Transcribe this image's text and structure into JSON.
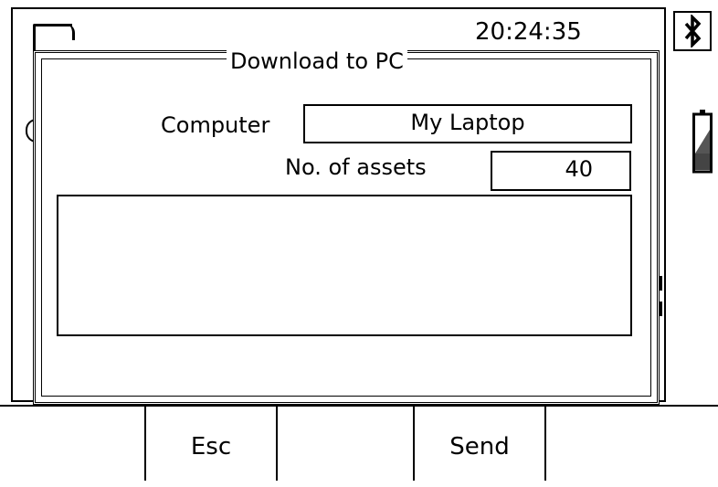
{
  "background": {
    "clock": "20:24:35"
  },
  "dialog": {
    "title": "Download to PC",
    "computer_label": "Computer",
    "computer_value": "My Laptop",
    "assets_label": "No. of assets",
    "assets_value": "40",
    "message": ""
  },
  "softkeys": {
    "esc": "Esc",
    "empty": "",
    "send": "Send"
  },
  "status_icons": [
    "bluetooth-icon",
    "battery-icon"
  ]
}
